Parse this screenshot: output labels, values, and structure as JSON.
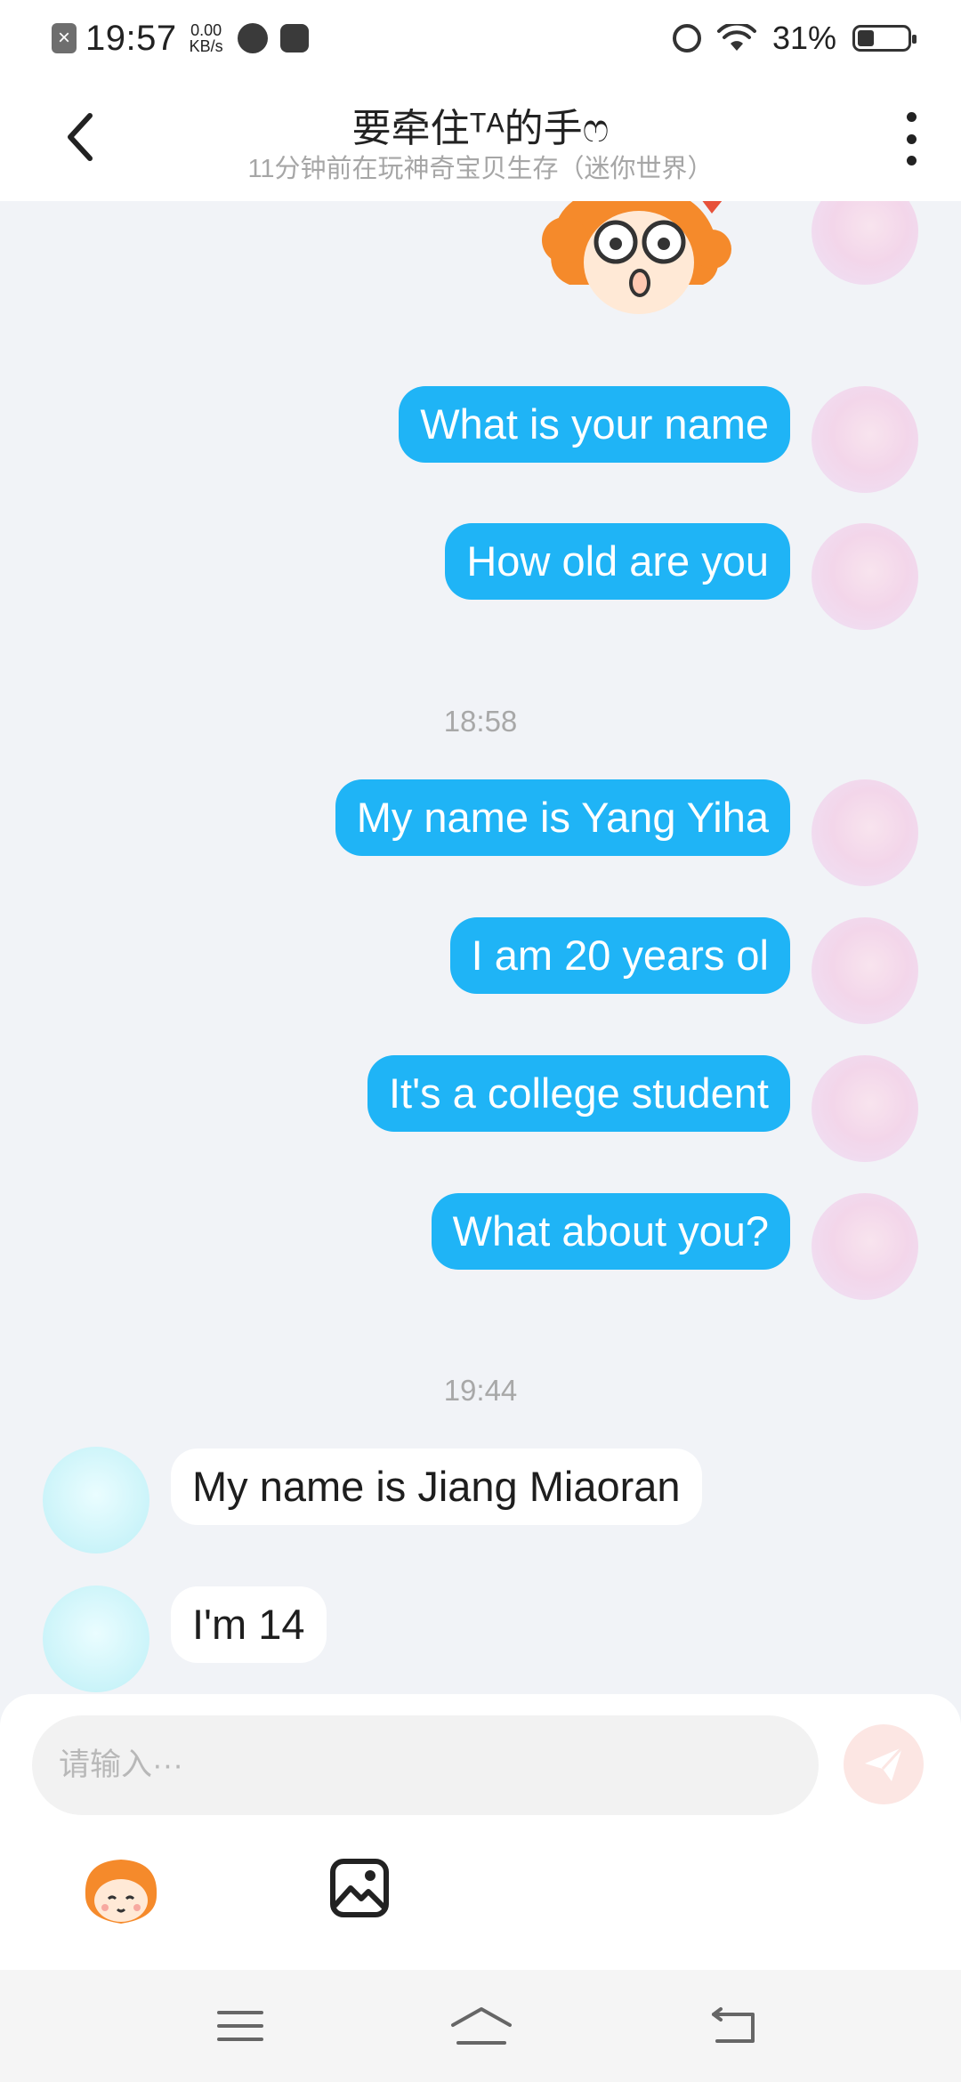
{
  "status_bar": {
    "time": "19:57",
    "speed_value": "0.00",
    "speed_unit": "KB/s",
    "battery": "31%"
  },
  "header": {
    "title": "要牵住ᵀᴬ的手ෆ",
    "subtitle": "11分钟前在玩神奇宝贝生存（迷你世界）"
  },
  "messages": [
    {
      "from": "me",
      "text": "What is your name"
    },
    {
      "from": "me",
      "text": "How old are you"
    },
    {
      "type": "time",
      "text": "18:58"
    },
    {
      "from": "me",
      "text": "My name is Yang Yiha"
    },
    {
      "from": "me",
      "text": "I am 20 years ol"
    },
    {
      "from": "me",
      "text": "It's a college student"
    },
    {
      "from": "me",
      "text": "What about you?"
    },
    {
      "type": "time",
      "text": "19:44"
    },
    {
      "from": "her",
      "text": "My name is Jiang Miaoran"
    },
    {
      "from": "her",
      "text": "I'm 14"
    }
  ],
  "input": {
    "placeholder": "请输入···"
  },
  "colors": {
    "my_bubble": "#1FB4F6",
    "their_bubble": "#FFFFFF",
    "chat_background": "#F1F3F7",
    "send_button_disabled": "#FCE6E3"
  },
  "icons": {
    "back": "chevron-left-icon",
    "more": "more-vertical-icon",
    "send": "paper-plane-icon",
    "emoji": "mascot-emoji-icon",
    "image": "image-icon",
    "nav_menu": "menu-icon",
    "nav_home": "home-icon",
    "nav_back": "back-icon"
  }
}
